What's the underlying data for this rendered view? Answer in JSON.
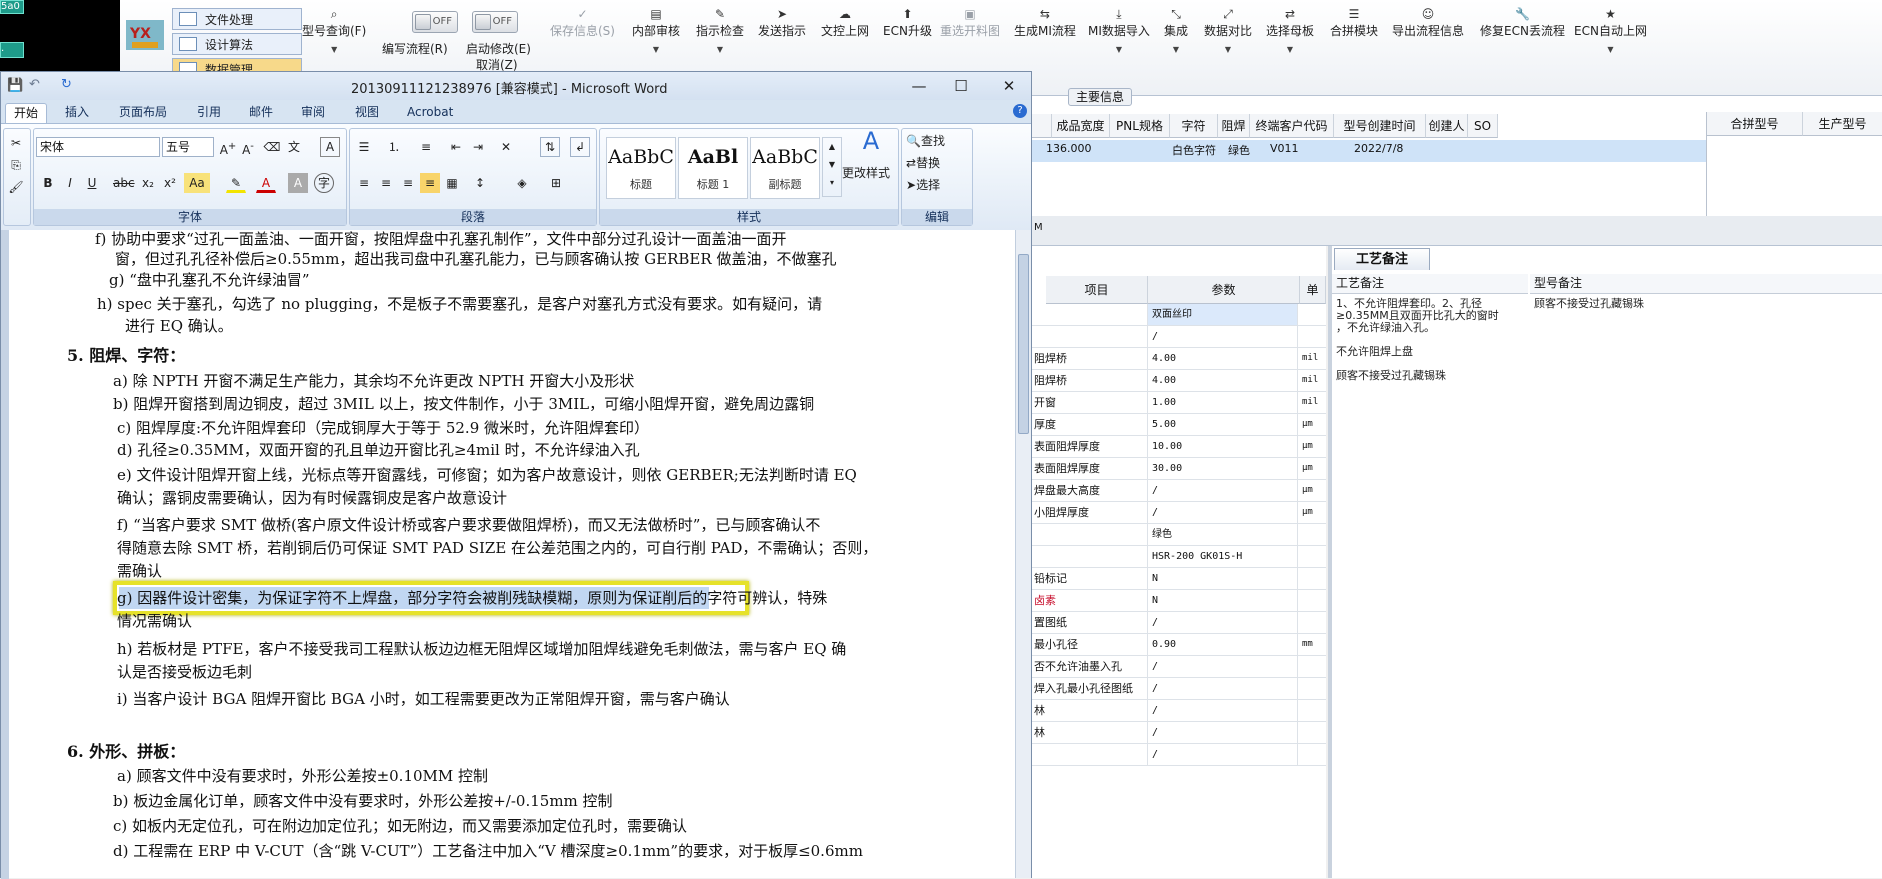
{
  "erp": {
    "left_tiles": [
      "5a0",
      "."
    ],
    "logo_text": "YX",
    "left_menu": [
      "文件处理",
      "设计算法",
      "数据管理"
    ],
    "toolbar": [
      {
        "label": "型号查询(F)",
        "icon": "search-icon",
        "has_dropdown": true
      },
      {
        "label": "编写流程(R)",
        "icon": "toggle-icon",
        "toggle": "OFF"
      },
      {
        "label": "启动修改(E)",
        "icon": "toggle-icon",
        "toggle": "OFF",
        "sub": "取消(Z)"
      },
      {
        "label": "保存信息(S)",
        "icon": "check-icon",
        "disabled": true
      },
      {
        "label": "内部审核",
        "icon": "review-icon",
        "has_dropdown": true
      },
      {
        "label": "指示检查",
        "icon": "edit-icon",
        "has_dropdown": true
      },
      {
        "label": "发送指示",
        "icon": "send-icon"
      },
      {
        "label": "文控上网",
        "icon": "upload-icon"
      },
      {
        "label": "ECN升级",
        "icon": "upgrade-icon"
      },
      {
        "label": "重选开料图",
        "icon": "cut-icon",
        "disabled": true
      },
      {
        "label": "生成MI流程",
        "icon": "flow-icon"
      },
      {
        "label": "MI数据导入",
        "icon": "import-icon",
        "has_dropdown": true
      },
      {
        "label": "集成",
        "icon": "integrate-icon",
        "has_dropdown": true
      },
      {
        "label": "数据对比",
        "icon": "compare-icon",
        "has_dropdown": true
      },
      {
        "label": "选择母板",
        "icon": "shuffle-icon",
        "has_dropdown": true
      },
      {
        "label": "合拼模块",
        "icon": "list-icon"
      },
      {
        "label": "导出流程信息",
        "icon": "smile-icon"
      },
      {
        "label": "修复ECN丢流程",
        "icon": "wrench-icon"
      },
      {
        "label": "ECN自动上网",
        "icon": "star-icon",
        "has_dropdown": true
      }
    ],
    "section_label": "主要信息",
    "grid_headers": [
      "成品宽度",
      "PNL规格",
      "字符",
      "阻焊",
      "终端客户代码",
      "型号创建时间",
      "创建人",
      "SO"
    ],
    "grid_row": {
      "width": "136.000",
      "char": "白色字符",
      "solder": "绿色",
      "customer": "V011",
      "created": "2022/7/8"
    },
    "right_headers": [
      "合拼型号",
      "生产型号"
    ],
    "mid_label": "M",
    "params_headers": [
      "项目",
      "参数",
      "单"
    ],
    "params_rows": [
      {
        "item": "",
        "value": "双面丝印",
        "unit": "",
        "blue": true
      },
      {
        "item": "",
        "value": "/",
        "unit": ""
      },
      {
        "item": "阻焊桥",
        "value": "4.00",
        "unit": "mil"
      },
      {
        "item": "阻焊桥",
        "value": "4.00",
        "unit": "mil"
      },
      {
        "item": "开窗",
        "value": "1.00",
        "unit": "mil"
      },
      {
        "item": "厚度",
        "value": "5.00",
        "unit": "μm"
      },
      {
        "item": "表面阻焊厚度",
        "value": "10.00",
        "unit": "μm"
      },
      {
        "item": "表面阻焊厚度",
        "value": "30.00",
        "unit": "μm"
      },
      {
        "item": "焊盘最大高度",
        "value": "/",
        "unit": "μm"
      },
      {
        "item": "小阻焊厚度",
        "value": "/",
        "unit": "μm"
      },
      {
        "item": "",
        "value": "绿色",
        "unit": ""
      },
      {
        "item": "",
        "value": "HSR-200 GK01S-H",
        "unit": ""
      },
      {
        "item": "铅标记",
        "value": "N",
        "unit": ""
      },
      {
        "item": "卤素",
        "value": "N",
        "unit": "",
        "red": true
      },
      {
        "item": "置图纸",
        "value": "/",
        "unit": ""
      },
      {
        "item": "最小孔径",
        "value": "0.90",
        "unit": "mm"
      },
      {
        "item": "否不允许油墨入孔",
        "value": "/",
        "unit": ""
      },
      {
        "item": "焊入孔最小孔径图纸",
        "value": "/",
        "unit": ""
      },
      {
        "item": "林",
        "value": "/",
        "unit": ""
      },
      {
        "item": "林",
        "value": "/",
        "unit": ""
      },
      {
        "item": "",
        "value": "/",
        "unit": ""
      }
    ],
    "proc_tab": "工艺备注",
    "proc_headers": [
      "工艺备注",
      "型号备注"
    ],
    "proc_text_1": "1、不允许阻焊套印。2、孔径\n≥0.35MM且双面开比孔大的窗时\n，不允许绿油入孔。",
    "proc_text_2": "不允许阻焊上盘",
    "proc_text_3": "顾客不接受过孔藏锡珠",
    "model_note": "顾客不接受过孔藏锡珠"
  },
  "word": {
    "title": "20130911121238976 [兼容模式] - Microsoft Word",
    "tabs": [
      "开始",
      "插入",
      "页面布局",
      "引用",
      "邮件",
      "审阅",
      "视图",
      "Acrobat"
    ],
    "font_name": "宋体",
    "font_size": "五号",
    "groups": {
      "font": "字体",
      "paragraph": "段落",
      "styles": "样式",
      "editing": "编辑"
    },
    "styles": [
      {
        "preview": "AaBbC",
        "label": "标题"
      },
      {
        "preview": "AaBl",
        "label": "标题 1"
      },
      {
        "preview": "AaBbC",
        "label": "副标题"
      }
    ],
    "change_styles": "更改样式",
    "editing": [
      "查找",
      "替换",
      "选择"
    ],
    "lines": [
      "f)  协助中要求“过孔一面盖油、一面开窗，按阻焊盘中孔塞孔制作”，文件中部分过孔设计一面盖油一面开",
      "窗，但过孔孔径补偿后≥0.55mm，超出我司盘中孔塞孔能力，已与顾客确认按 GERBER 做盖油，不做塞孔",
      "g)  “盘中孔塞孔不允许绿油冒”",
      "h) spec 关于塞孔，勾选了 no plugging，不是板子不需要塞孔，是客户对塞孔方式没有要求。如有疑问，请",
      "进行 EQ 确认。",
      "5. 阻焊、字符：",
      "a) 除 NPTH 开窗不满足生产能力，其余均不允许更改 NPTH 开窗大小及形状",
      "b) 阻焊开窗搭到周边铜皮，超过 3MIL 以上，按文件制作，小于 3MIL，可缩小阻焊开窗，避免周边露铜",
      "c) 阻焊厚度:不允许阻焊套印（完成铜厚大于等于 52.9 微米时，允许阻焊套印）",
      "d) 孔径≥0.35MM，双面开窗的孔且单边开窗比孔≥4mil 时，不允许绿油入孔",
      "e) 文件设计阻焊开窗上线，光标点等开窗露线，可修窗；如为客户故意设计，则依 GERBER;无法判断时请 EQ",
      "确认；露铜皮需要确认，因为有时候露铜皮是客户故意设计",
      "f) “当客户要求 SMT 做桥(客户原文件设计桥或客户要求要做阻焊桥)，而又无法做桥时”，已与顾客确认不",
      "得随意去除 SMT 桥，若削铜后仍可保证 SMT PAD SIZE 在公差范围之内的，可自行削 PAD，不需确认；否则，",
      "需确认",
      "g) 因器件设计密集，为保证字符不上焊盘，部分字符会被削残缺模糊，原则为保证削后的字符可辨认，特殊",
      "情况需确认",
      "h) 若板材是 PTFE，客户不接受我司工程默认板边边框无阻焊区域增加阻焊线避免毛刺做法，需与客户 EQ 确",
      "认是否接受板边毛刺",
      "i) 当客户设计 BGA 阻焊开窗比 BGA 小时，如工程需要更改为正常阻焊开窗，需与客户确认",
      "6. 外形、拼板：",
      "a) 顾客文件中没有要求时，外形公差按±0.10MM 控制",
      "b) 板边金属化订单，顾客文件中没有要求时，外形公差按+/-0.15mm 控制",
      "c) 如板内无定位孔，可在附边加定位孔；如无附边，而又需要添加定位孔时，需要确认",
      "d) 工程需在 ERP 中 V-CUT（含“跳 V-CUT”）工艺备注中加入“V 槽深度≥0.1mm”的要求，对于板厚≤0.6mm"
    ]
  }
}
